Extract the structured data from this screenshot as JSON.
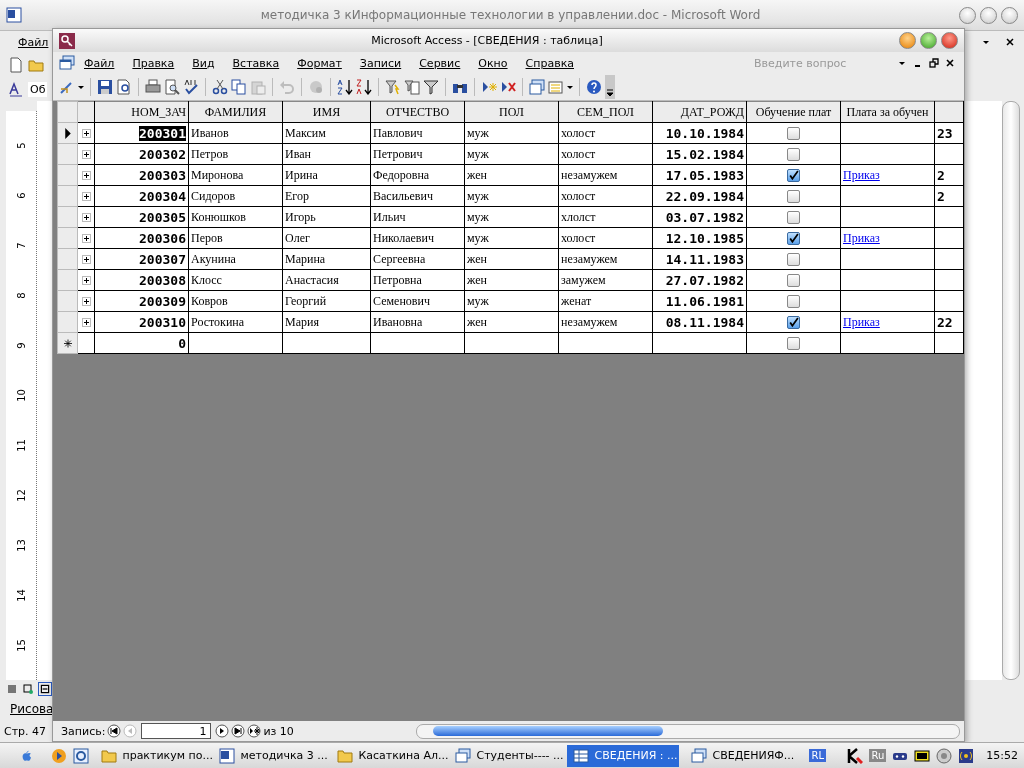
{
  "word": {
    "title": "методичка 3 кИнформационные технологии в управлении.doc - Microsoft Word",
    "menu": [
      "Файл"
    ],
    "style_label": "Об",
    "ruler_numbers": [
      "5",
      "6",
      "7",
      "8",
      "9",
      "10",
      "11",
      "12",
      "13",
      "14",
      "15"
    ],
    "draw_toolbar": "Рисова",
    "status": "Стр. 47"
  },
  "access": {
    "title": "Microsoft Access - [СВЕДЕНИЯ : таблица]",
    "menu": [
      "Файл",
      "Правка",
      "Вид",
      "Вставка",
      "Формат",
      "Записи",
      "Сервис",
      "Окно",
      "Справка"
    ],
    "help_search": {
      "placeholder": "Введите вопрос"
    },
    "table": {
      "columns": [
        "НОМ_ЗАЧ",
        "ФАМИЛИЯ",
        "ИМЯ",
        "ОТЧЕСТВО",
        "ПОЛ",
        "СЕМ_ПОЛ",
        "ДАТ_РОЖД",
        "Обучение плат",
        "Плата за обучен"
      ],
      "rows": [
        {
          "selected": true,
          "expanded": false,
          "id": "200301",
          "last": "Иванов",
          "first": "Максим",
          "patronymic": "Павлович",
          "sex": "муж",
          "marital": "холост",
          "dob": "10.10.1984",
          "paid": false,
          "payment": "",
          "column_11": "23"
        },
        {
          "selected": false,
          "expanded": false,
          "id": "200302",
          "last": "Петров",
          "first": "Иван",
          "patronymic": "Петрович",
          "sex": "муж",
          "marital": "холост",
          "dob": "15.02.1984",
          "paid": false,
          "payment": "",
          "column_11": ""
        },
        {
          "selected": false,
          "expanded": false,
          "id": "200303",
          "last": "Миронова",
          "first": "Ирина",
          "patronymic": "Федоровна",
          "sex": "жен",
          "marital": "незамужем",
          "dob": "17.05.1983",
          "paid": true,
          "payment": "Приказ",
          "column_11": "2"
        },
        {
          "selected": false,
          "expanded": false,
          "id": "200304",
          "last": "Сидоров",
          "first": "Егор",
          "patronymic": "Васильевич",
          "sex": "муж",
          "marital": "холост",
          "dob": "22.09.1984",
          "paid": false,
          "payment": "",
          "column_11": "2"
        },
        {
          "selected": false,
          "expanded": false,
          "id": "200305",
          "last": "Конюшков",
          "first": "Игорь",
          "patronymic": "Ильич",
          "sex": "муж",
          "marital": "хлолст",
          "dob": "03.07.1982",
          "paid": false,
          "payment": "",
          "column_11": ""
        },
        {
          "selected": false,
          "expanded": false,
          "id": "200306",
          "last": "Перов",
          "first": "Олег",
          "patronymic": "Николаевич",
          "sex": "муж",
          "marital": "холост",
          "dob": "12.10.1985",
          "paid": true,
          "payment": "Приказ",
          "column_11": ""
        },
        {
          "selected": false,
          "expanded": false,
          "id": "200307",
          "last": "Акунина",
          "first": "Марина",
          "patronymic": "Сергеевна",
          "sex": "жен",
          "marital": "незамужем",
          "dob": "14.11.1983",
          "paid": false,
          "payment": "",
          "column_11": ""
        },
        {
          "selected": false,
          "expanded": false,
          "id": "200308",
          "last": "Клосс",
          "first": "Анастасия",
          "patronymic": "Петровна",
          "sex": "жен",
          "marital": "замужем",
          "dob": "27.07.1982",
          "paid": false,
          "payment": "",
          "column_11": ""
        },
        {
          "selected": false,
          "expanded": false,
          "id": "200309",
          "last": "Ковров",
          "first": "Георгий",
          "patronymic": "Семенович",
          "sex": "муж",
          "marital": "женат",
          "dob": "11.06.1981",
          "paid": false,
          "payment": "",
          "column_11": ""
        },
        {
          "selected": false,
          "expanded": false,
          "id": "200310",
          "last": "Ростокина",
          "first": "Мария",
          "patronymic": "Ивановна",
          "sex": "жен",
          "marital": "незамужем",
          "dob": "08.11.1984",
          "paid": true,
          "payment": "Приказ",
          "column_11": "22"
        }
      ],
      "new_row": {
        "id": "0",
        "paid": false
      }
    },
    "navigator": {
      "label": "Запись:",
      "record": "1",
      "total": "из 10"
    }
  },
  "taskbar": {
    "buttons": [
      {
        "label": "практикум по...",
        "kind": "folder",
        "selected": false
      },
      {
        "label": "методичка 3 ...",
        "kind": "word",
        "selected": false
      },
      {
        "label": "Касаткина Ал...",
        "kind": "folder",
        "selected": false
      },
      {
        "label": "Студенты---- ...",
        "kind": "access",
        "selected": false
      },
      {
        "label": "СВЕДЕНИЯ : ...",
        "kind": "table",
        "selected": true
      },
      {
        "label": "СВЕДЕНИЯФ...",
        "kind": "access",
        "selected": false
      }
    ],
    "lang": "RL",
    "keyboard": "Ru",
    "clock": "15:52"
  }
}
